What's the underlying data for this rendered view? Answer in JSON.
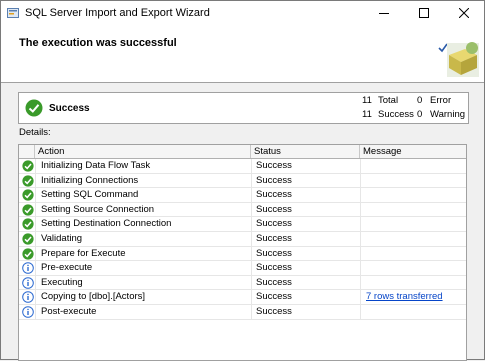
{
  "window": {
    "title": "SQL Server Import and Export Wizard"
  },
  "header": {
    "title": "The execution was successful"
  },
  "summary": {
    "status": "Success",
    "total_count": "11",
    "total_label": "Total",
    "error_count": "0",
    "error_label": "Error",
    "success_count": "11",
    "success_label": "Success",
    "warning_count": "0",
    "warning_label": "Warning"
  },
  "details": {
    "label": "Details:",
    "columns": [
      "Action",
      "Status",
      "Message"
    ],
    "rows": [
      {
        "icon": "success-check-icon",
        "action": "Initializing Data Flow Task",
        "status": "Success",
        "message": ""
      },
      {
        "icon": "success-check-icon",
        "action": "Initializing Connections",
        "status": "Success",
        "message": ""
      },
      {
        "icon": "success-check-icon",
        "action": "Setting SQL Command",
        "status": "Success",
        "message": ""
      },
      {
        "icon": "success-check-icon",
        "action": "Setting Source Connection",
        "status": "Success",
        "message": ""
      },
      {
        "icon": "success-check-icon",
        "action": "Setting Destination Connection",
        "status": "Success",
        "message": ""
      },
      {
        "icon": "success-check-icon",
        "action": "Validating",
        "status": "Success",
        "message": ""
      },
      {
        "icon": "success-check-icon",
        "action": "Prepare for Execute",
        "status": "Success",
        "message": ""
      },
      {
        "icon": "info-icon",
        "action": "Pre-execute",
        "status": "Success",
        "message": ""
      },
      {
        "icon": "info-icon",
        "action": "Executing",
        "status": "Success",
        "message": ""
      },
      {
        "icon": "info-icon",
        "action": "Copying to [dbo].[Actors]",
        "status": "Success",
        "message": "7 rows transferred"
      },
      {
        "icon": "info-icon",
        "action": "Post-execute",
        "status": "Success",
        "message": ""
      }
    ]
  },
  "colors": {
    "success_green": "#3a9a2a",
    "info_blue": "#2e6bd1",
    "link": "#0645c8"
  }
}
